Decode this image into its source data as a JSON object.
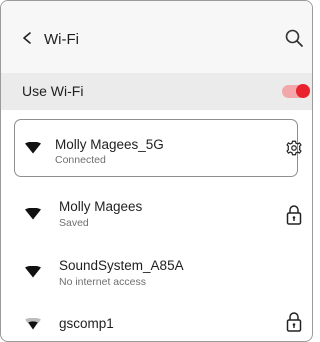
{
  "header": {
    "title": "Wi-Fi",
    "back_icon": "back-chevron-icon",
    "search_icon": "search-icon"
  },
  "use_wifi": {
    "label": "Use Wi-Fi",
    "enabled": true,
    "accent_color": "#e8232d"
  },
  "networks": [
    {
      "name": "Molly Magees_5G",
      "status": "Connected",
      "signal_icon": "wifi-signal-icon",
      "trailing_icon": "gear-icon",
      "selected": true
    },
    {
      "name": "Molly Magees",
      "status": "Saved",
      "signal_icon": "wifi-signal-icon",
      "trailing_icon": "lock-icon",
      "selected": false
    },
    {
      "name": "SoundSystem_A85A",
      "status": "No internet access",
      "signal_icon": "wifi-signal-icon",
      "trailing_icon": "",
      "selected": false
    },
    {
      "name": "gscomp1",
      "status": "",
      "signal_icon": "wifi-signal-icon",
      "trailing_icon": "lock-icon",
      "selected": false
    }
  ]
}
